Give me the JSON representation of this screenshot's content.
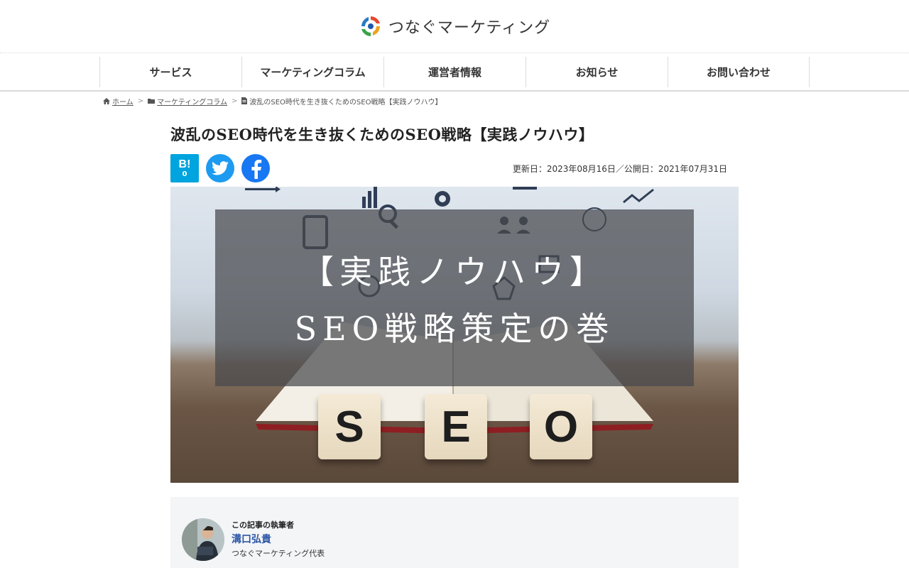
{
  "header": {
    "logo_text": "つなぐマーケティング",
    "logo_icon": "circular-arrows-logo"
  },
  "nav": {
    "items": [
      {
        "label": "サービス"
      },
      {
        "label": "マーケティングコラム"
      },
      {
        "label": "運営者情報"
      },
      {
        "label": "お知らせ"
      },
      {
        "label": "お問い合わせ"
      }
    ]
  },
  "breadcrumb": {
    "home": "ホーム",
    "category": "マーケティングコラム",
    "current": "波乱のSEO時代を生き抜くためのSEO戦略【実践ノウハウ】",
    "separator": ">",
    "icons": [
      "home-icon",
      "folder-icon",
      "document-icon"
    ]
  },
  "article": {
    "title": "波乱のSEO時代を生き抜くためのSEO戦略【実践ノウハウ】",
    "dates": "更新日：2023年08月16日／公開日：2021年07月31日",
    "share": {
      "hatena_label": "B!",
      "hatena_count": "0",
      "icons": [
        "hatena-bookmark-icon",
        "twitter-icon",
        "facebook-icon"
      ],
      "colors": {
        "hatena": "#00a4de",
        "twitter": "#1d9bf0",
        "facebook": "#1877f2"
      }
    },
    "hero": {
      "line1": "【実践ノウハウ】",
      "line2": "SEO戦略策定の巻",
      "cubes": [
        "S",
        "E",
        "O"
      ]
    }
  },
  "author": {
    "label": "この記事の執筆者",
    "name": "溝口弘貴",
    "role": "つなぐマーケティング代表",
    "name_color": "#2d57a6"
  }
}
